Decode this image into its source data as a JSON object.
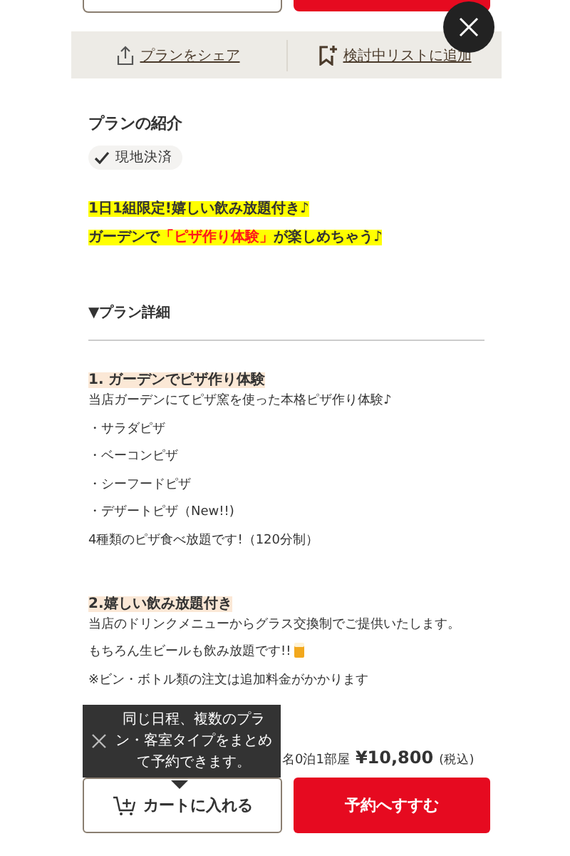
{
  "share_bar": {
    "share": "プランをシェア",
    "wishlist": "検討中リストに追加"
  },
  "intro": {
    "title": "プランの紹介",
    "tag": "現地決済"
  },
  "highlights": [
    [
      {
        "text": "1日1組限定!嬉しい飲み放題付き♪",
        "accent": false
      }
    ],
    [
      {
        "text": "ガーデンで",
        "accent": false
      },
      {
        "text": "「ピザ作り体験」",
        "accent": true
      },
      {
        "text": "が楽しめちゃう♪",
        "accent": false
      }
    ]
  ],
  "details_title": "▼プラン詳細",
  "sections": [
    {
      "heading": "1. ガーデンでピザ作り体験",
      "lines": [
        {
          "text": "当店ガーデンにてピザ窯を使った本格ピザ作り体験♪",
          "beer": false
        },
        {
          "text": "・サラダピザ",
          "beer": false
        },
        {
          "text": "・ベーコンピザ",
          "beer": false
        },
        {
          "text": "・シーフードピザ",
          "beer": false
        },
        {
          "text": "・デザートピザ（New!!)",
          "beer": false
        },
        {
          "text": "4種類のピザ食べ放題です!（120分制）",
          "beer": false
        }
      ]
    },
    {
      "heading": "2.嬉しい飲み放題付き",
      "lines": [
        {
          "text": "当店のドリンクメニューからグラス交換制でご提供いたします。",
          "beer": false
        },
        {
          "text": "もちろん生ビールも飲み放題です!!",
          "beer": true
        },
        {
          "text": "※ビン・ボトル類の注文は追加料金がかかります",
          "beer": false
        }
      ]
    }
  ],
  "price": {
    "fragment": "名0泊1部屋",
    "amount": "¥10,800",
    "tax": "(税込)"
  },
  "tooltip": {
    "text": "同じ日程、複数のプラン・客室タイプをまとめて予約できます。"
  },
  "actions": {
    "cart": "カートに入れる",
    "reserve": "予約へすすむ"
  }
}
